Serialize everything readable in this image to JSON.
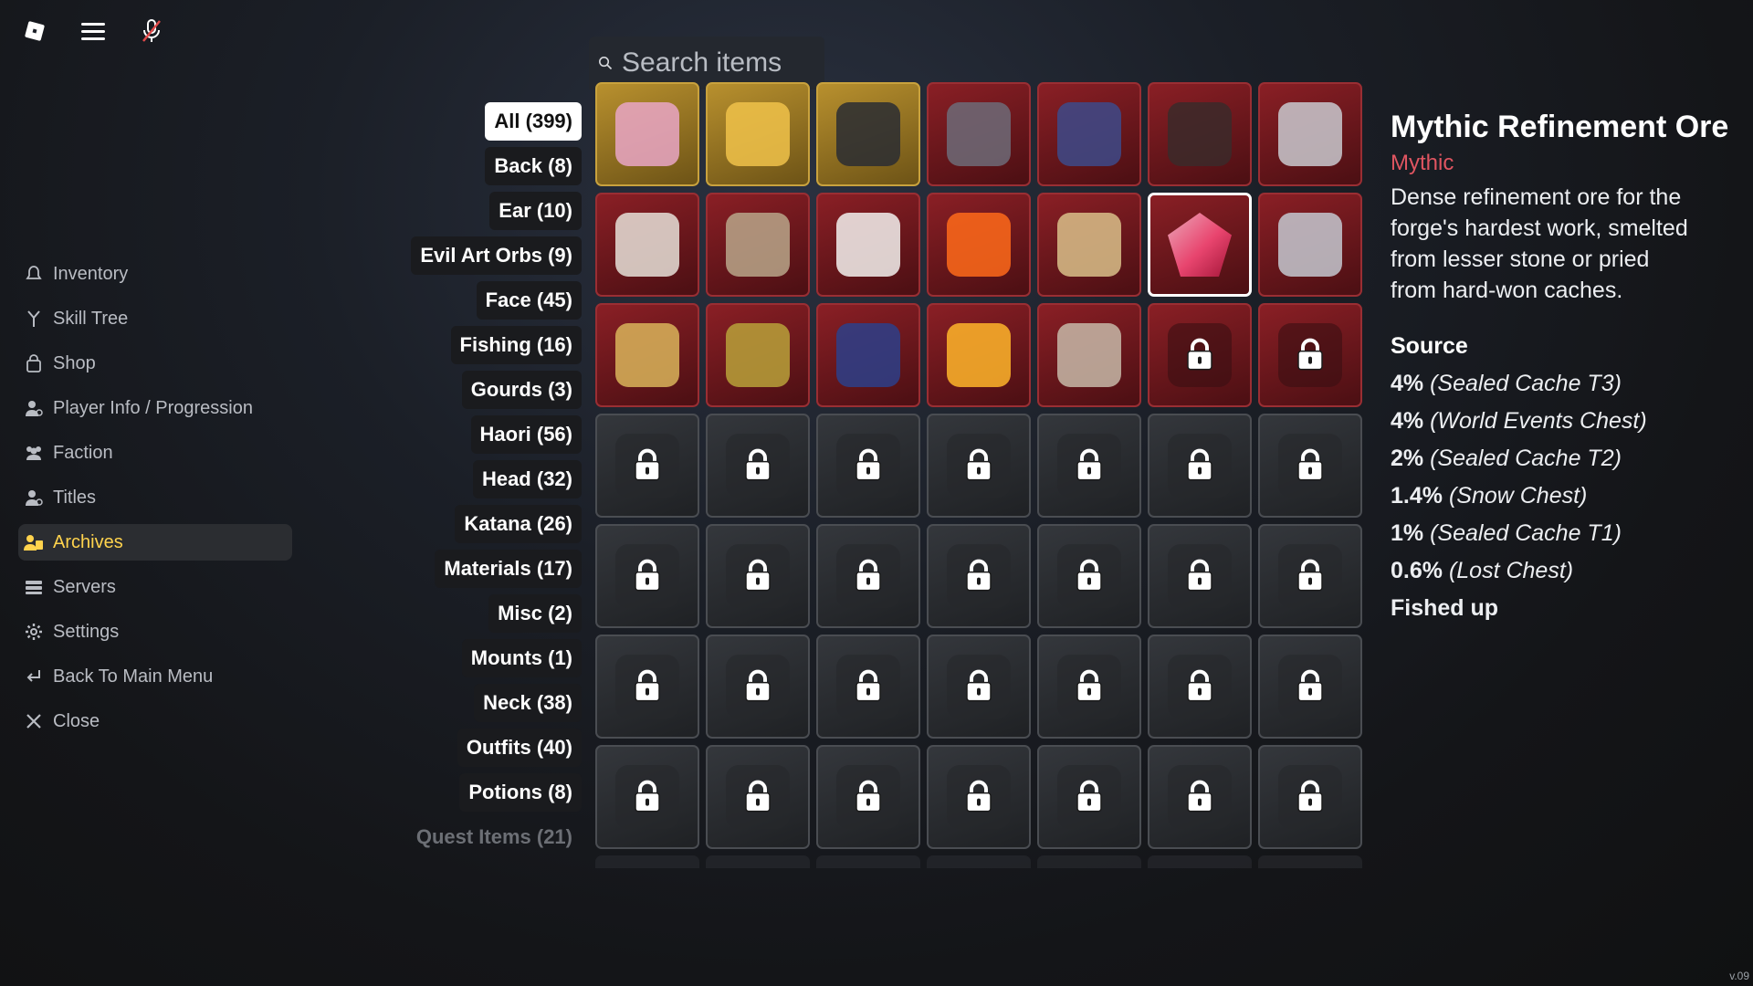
{
  "topbar": {
    "icons": [
      "roblox-icon",
      "menu-icon",
      "mic-muted-icon"
    ]
  },
  "sidebar": {
    "items": [
      {
        "label": "Inventory",
        "icon": "bell-icon"
      },
      {
        "label": "Skill Tree",
        "icon": "branch-icon"
      },
      {
        "label": "Shop",
        "icon": "bag-icon"
      },
      {
        "label": "Player Info / Progression",
        "icon": "person-icon"
      },
      {
        "label": "Faction",
        "icon": "group-icon"
      },
      {
        "label": "Titles",
        "icon": "person-icon"
      },
      {
        "label": "Archives",
        "icon": "archive-icon",
        "active": true
      },
      {
        "label": "Servers",
        "icon": "server-icon"
      },
      {
        "label": "Settings",
        "icon": "gear-icon"
      },
      {
        "label": "Back To Main Menu",
        "icon": "return-icon"
      },
      {
        "label": "Close",
        "icon": "close-icon"
      }
    ]
  },
  "categories": [
    "All (399)",
    "Back (8)",
    "Ear (10)",
    "Evil Art Orbs (9)",
    "Face (45)",
    "Fishing (16)",
    "Gourds (3)",
    "Haori (56)",
    "Head (32)",
    "Katana (26)",
    "Materials (17)",
    "Misc (2)",
    "Mounts (1)",
    "Neck (38)",
    "Outfits (40)",
    "Potions (8)",
    "Quest Items (21)"
  ],
  "search": {
    "placeholder": "Search items"
  },
  "grid": {
    "rows": [
      [
        "gold",
        "gold",
        "gold",
        "red",
        "red",
        "red",
        "red"
      ],
      [
        "red",
        "red",
        "red",
        "red",
        "red",
        "red-selected",
        "red"
      ],
      [
        "red",
        "red",
        "red",
        "red",
        "red",
        "red-locked",
        "red-locked"
      ],
      [
        "locked",
        "locked",
        "locked",
        "locked",
        "locked",
        "locked",
        "locked"
      ],
      [
        "locked",
        "locked",
        "locked",
        "locked",
        "locked",
        "locked",
        "locked"
      ],
      [
        "locked",
        "locked",
        "locked",
        "locked",
        "locked",
        "locked",
        "locked"
      ],
      [
        "locked",
        "locked",
        "locked",
        "locked",
        "locked",
        "locked",
        "locked"
      ]
    ]
  },
  "detail": {
    "title": "Mythic Refinement Ore",
    "rarity": "Mythic",
    "rarity_color": "#e05561",
    "description": "Dense refinement ore for the forge's hardest work, smelted from lesser stone or pried from hard-won caches.",
    "source_heading": "Source",
    "sources": [
      {
        "pct": "4%",
        "where": "(Sealed Cache T3)"
      },
      {
        "pct": "4%",
        "where": "(World Events Chest)"
      },
      {
        "pct": "2%",
        "where": "(Sealed Cache T2)"
      },
      {
        "pct": "1.4%",
        "where": "(Snow Chest)"
      },
      {
        "pct": "1%",
        "where": "(Sealed Cache T1)"
      },
      {
        "pct": "0.6%",
        "where": "(Lost Chest)"
      }
    ],
    "extra": "Fished up"
  },
  "version": "v.09",
  "colors": {
    "accent": "#ffd34d",
    "gold_tile": "#b8902e",
    "red_tile": "#8a1f25",
    "locked_tile": "#34373c"
  }
}
